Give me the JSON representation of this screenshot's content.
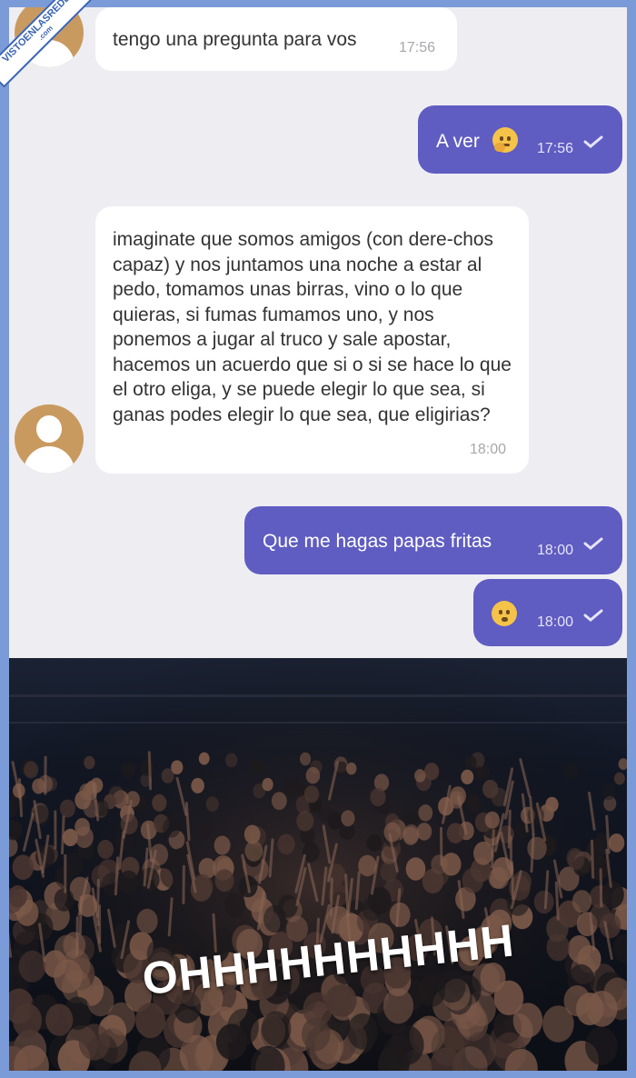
{
  "watermark": {
    "text": "VISTOENLASREDES",
    "sub": ".com"
  },
  "messages": [
    {
      "side": "in",
      "text": "tengo una pregunta para vos",
      "time": "17:56"
    },
    {
      "side": "out",
      "text": "A ver",
      "emoji": "thinking-face-emoji",
      "time": "17:56"
    },
    {
      "side": "in",
      "text": "imaginate que somos amigos (con dere-chos capaz) y nos juntamos una noche a estar al pedo, tomamos unas birras, vino o lo que quieras, si fumas fumamos uno, y nos ponemos a jugar al truco y sale apostar, hacemos un acuerdo que si o si se hace lo que el otro eliga, y se puede elegir lo que sea, si ganas podes elegir lo que sea, que eligirias?",
      "time": "18:00"
    },
    {
      "side": "out",
      "text": "Que me hagas papas fritas",
      "time": "18:00"
    },
    {
      "side": "out",
      "emoji": "hushed-face-emoji",
      "time": "18:00"
    }
  ],
  "meme": {
    "caption": "OHHHHHHHHHH"
  },
  "colors": {
    "outgoing": "#5f5cc2",
    "incoming": "#ffffff",
    "background": "#eeedf2",
    "border": "#7b9bd8"
  }
}
